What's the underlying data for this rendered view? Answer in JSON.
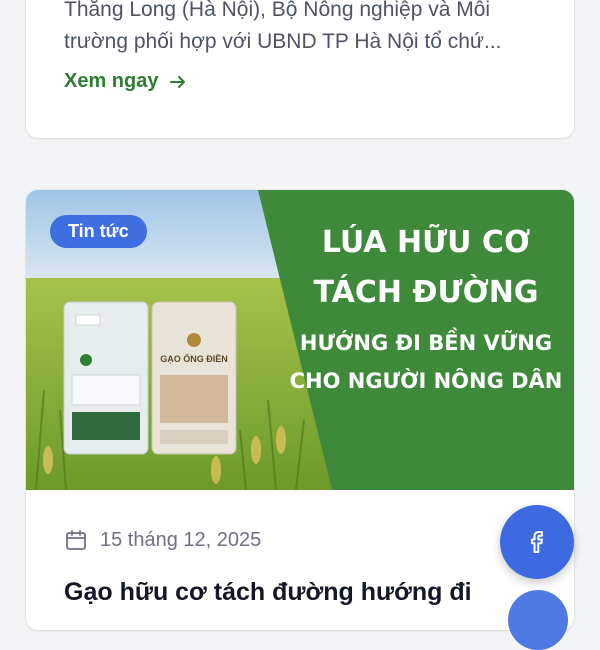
{
  "top_card": {
    "excerpt_line1": "Thăng Long (Hà Nội), Bộ Nông nghiệp và Môi",
    "excerpt_line2": "trường phối hợp với UBND TP Hà Nội tổ chứ...",
    "read_more_label": "Xem ngay"
  },
  "main_card": {
    "badge": "Tin tức",
    "banner": {
      "line1": "LÚA HỮU CƠ",
      "line2": "TÁCH ĐƯỜNG",
      "line3": "HƯỚNG ĐI BỀN VỮNG",
      "line4": "CHO NGƯỜI NÔNG DÂN",
      "package_brand": "GẠO ỐNG ĐIỀN"
    },
    "date": "15 tháng 12, 2025",
    "title": "Gạo hữu cơ tách đường hướng đi"
  },
  "fab": {
    "icon": "facebook-icon"
  },
  "colors": {
    "accent_green": "#2e7d32",
    "badge_blue": "#3f6ee0",
    "banner_green": "#3e8a3a"
  }
}
